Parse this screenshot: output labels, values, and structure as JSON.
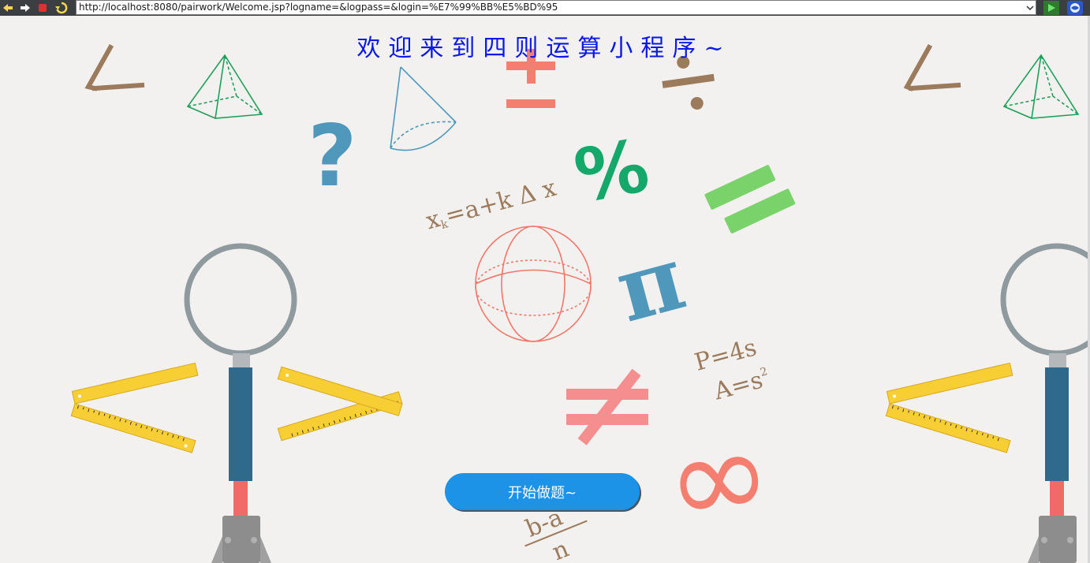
{
  "browser": {
    "url": "http://localhost:8080/pairwork/Welcome.jsp?logname=&logpass=&login=%E7%99%BB%E5%BD%95",
    "icons": [
      "back-arrow-icon",
      "forward-arrow-icon",
      "stop-icon",
      "refresh-icon",
      "dropdown-icon",
      "go-icon",
      "browser-extension-icon"
    ]
  },
  "page": {
    "title": "欢迎来到四则运算小程序~",
    "start_button": "开始做题~"
  },
  "decorations": {
    "formula_x": "x",
    "formula_k": "k",
    "formula_rest": "=a+k Δ x",
    "perimeter": "P=4s",
    "area": "A=s",
    "area_exp": "2",
    "fraction_top": "b-a",
    "fraction_bottom": "n",
    "question": "?",
    "percent": "%",
    "pi": "π",
    "plus_minus": "±",
    "divide": "÷",
    "infinity": "∞"
  },
  "colors": {
    "title": "#0b19e6",
    "button": "#1c93e6",
    "salmon": "#f47f70",
    "green": "#14a86b",
    "lightgreen": "#7ad36a",
    "teal": "#4f98bb",
    "brown": "#9c7a5c",
    "yellow": "#f7cf35"
  }
}
